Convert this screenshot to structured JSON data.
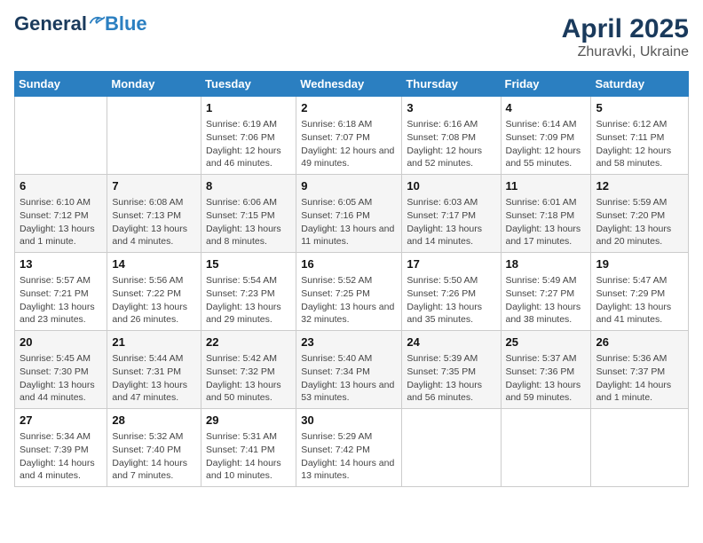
{
  "logo": {
    "general": "General",
    "blue": "Blue"
  },
  "title": "April 2025",
  "subtitle": "Zhuravki, Ukraine",
  "days_of_week": [
    "Sunday",
    "Monday",
    "Tuesday",
    "Wednesday",
    "Thursday",
    "Friday",
    "Saturday"
  ],
  "weeks": [
    [
      {
        "day": "",
        "info": ""
      },
      {
        "day": "",
        "info": ""
      },
      {
        "day": "1",
        "info": "Sunrise: 6:19 AM\nSunset: 7:06 PM\nDaylight: 12 hours and 46 minutes."
      },
      {
        "day": "2",
        "info": "Sunrise: 6:18 AM\nSunset: 7:07 PM\nDaylight: 12 hours and 49 minutes."
      },
      {
        "day": "3",
        "info": "Sunrise: 6:16 AM\nSunset: 7:08 PM\nDaylight: 12 hours and 52 minutes."
      },
      {
        "day": "4",
        "info": "Sunrise: 6:14 AM\nSunset: 7:09 PM\nDaylight: 12 hours and 55 minutes."
      },
      {
        "day": "5",
        "info": "Sunrise: 6:12 AM\nSunset: 7:11 PM\nDaylight: 12 hours and 58 minutes."
      }
    ],
    [
      {
        "day": "6",
        "info": "Sunrise: 6:10 AM\nSunset: 7:12 PM\nDaylight: 13 hours and 1 minute."
      },
      {
        "day": "7",
        "info": "Sunrise: 6:08 AM\nSunset: 7:13 PM\nDaylight: 13 hours and 4 minutes."
      },
      {
        "day": "8",
        "info": "Sunrise: 6:06 AM\nSunset: 7:15 PM\nDaylight: 13 hours and 8 minutes."
      },
      {
        "day": "9",
        "info": "Sunrise: 6:05 AM\nSunset: 7:16 PM\nDaylight: 13 hours and 11 minutes."
      },
      {
        "day": "10",
        "info": "Sunrise: 6:03 AM\nSunset: 7:17 PM\nDaylight: 13 hours and 14 minutes."
      },
      {
        "day": "11",
        "info": "Sunrise: 6:01 AM\nSunset: 7:18 PM\nDaylight: 13 hours and 17 minutes."
      },
      {
        "day": "12",
        "info": "Sunrise: 5:59 AM\nSunset: 7:20 PM\nDaylight: 13 hours and 20 minutes."
      }
    ],
    [
      {
        "day": "13",
        "info": "Sunrise: 5:57 AM\nSunset: 7:21 PM\nDaylight: 13 hours and 23 minutes."
      },
      {
        "day": "14",
        "info": "Sunrise: 5:56 AM\nSunset: 7:22 PM\nDaylight: 13 hours and 26 minutes."
      },
      {
        "day": "15",
        "info": "Sunrise: 5:54 AM\nSunset: 7:23 PM\nDaylight: 13 hours and 29 minutes."
      },
      {
        "day": "16",
        "info": "Sunrise: 5:52 AM\nSunset: 7:25 PM\nDaylight: 13 hours and 32 minutes."
      },
      {
        "day": "17",
        "info": "Sunrise: 5:50 AM\nSunset: 7:26 PM\nDaylight: 13 hours and 35 minutes."
      },
      {
        "day": "18",
        "info": "Sunrise: 5:49 AM\nSunset: 7:27 PM\nDaylight: 13 hours and 38 minutes."
      },
      {
        "day": "19",
        "info": "Sunrise: 5:47 AM\nSunset: 7:29 PM\nDaylight: 13 hours and 41 minutes."
      }
    ],
    [
      {
        "day": "20",
        "info": "Sunrise: 5:45 AM\nSunset: 7:30 PM\nDaylight: 13 hours and 44 minutes."
      },
      {
        "day": "21",
        "info": "Sunrise: 5:44 AM\nSunset: 7:31 PM\nDaylight: 13 hours and 47 minutes."
      },
      {
        "day": "22",
        "info": "Sunrise: 5:42 AM\nSunset: 7:32 PM\nDaylight: 13 hours and 50 minutes."
      },
      {
        "day": "23",
        "info": "Sunrise: 5:40 AM\nSunset: 7:34 PM\nDaylight: 13 hours and 53 minutes."
      },
      {
        "day": "24",
        "info": "Sunrise: 5:39 AM\nSunset: 7:35 PM\nDaylight: 13 hours and 56 minutes."
      },
      {
        "day": "25",
        "info": "Sunrise: 5:37 AM\nSunset: 7:36 PM\nDaylight: 13 hours and 59 minutes."
      },
      {
        "day": "26",
        "info": "Sunrise: 5:36 AM\nSunset: 7:37 PM\nDaylight: 14 hours and 1 minute."
      }
    ],
    [
      {
        "day": "27",
        "info": "Sunrise: 5:34 AM\nSunset: 7:39 PM\nDaylight: 14 hours and 4 minutes."
      },
      {
        "day": "28",
        "info": "Sunrise: 5:32 AM\nSunset: 7:40 PM\nDaylight: 14 hours and 7 minutes."
      },
      {
        "day": "29",
        "info": "Sunrise: 5:31 AM\nSunset: 7:41 PM\nDaylight: 14 hours and 10 minutes."
      },
      {
        "day": "30",
        "info": "Sunrise: 5:29 AM\nSunset: 7:42 PM\nDaylight: 14 hours and 13 minutes."
      },
      {
        "day": "",
        "info": ""
      },
      {
        "day": "",
        "info": ""
      },
      {
        "day": "",
        "info": ""
      }
    ]
  ]
}
